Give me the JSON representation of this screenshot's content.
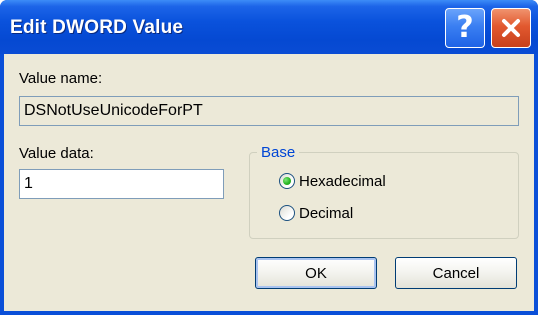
{
  "window": {
    "title": "Edit DWORD Value",
    "help_icon": "help-icon",
    "close_icon": "close-icon"
  },
  "value_name": {
    "label": "Value name:",
    "value": "DSNotUseUnicodeForPT"
  },
  "value_data": {
    "label": "Value data:",
    "value": "1"
  },
  "base": {
    "legend": "Base",
    "options": [
      {
        "label": "Hexadecimal",
        "selected": true
      },
      {
        "label": "Decimal",
        "selected": false
      }
    ]
  },
  "buttons": {
    "ok_label": "OK",
    "cancel_label": "Cancel"
  },
  "colors": {
    "titlebar": "#0a52dc",
    "client": "#ece9d8",
    "close": "#e2592f",
    "group_legend": "#0046d5",
    "radio_selected": "#29b825"
  }
}
